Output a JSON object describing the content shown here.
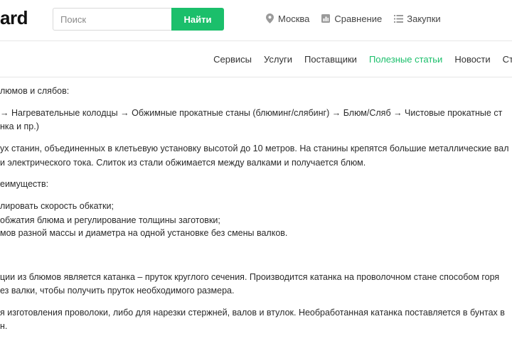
{
  "header": {
    "logo_text": "ard",
    "search": {
      "placeholder": "Поиск",
      "button_label": "Найти"
    },
    "links": [
      {
        "icon": "location-pin-icon",
        "label": "Москва"
      },
      {
        "icon": "compare-icon",
        "label": "Сравнение"
      },
      {
        "icon": "list-icon",
        "label": "Закупки"
      }
    ]
  },
  "nav": {
    "items": [
      {
        "label": "Сервисы",
        "active": false
      },
      {
        "label": "Услуги",
        "active": false
      },
      {
        "label": "Поставщики",
        "active": false
      },
      {
        "label": "Полезные статьи",
        "active": true
      },
      {
        "label": "Новости",
        "active": false
      },
      {
        "label": "Ст",
        "active": false
      }
    ]
  },
  "article": {
    "lines": [
      "люмов и слябов:",
      "→ Нагревательные колодцы → Обжимные прокатные станы (блюминг/слябинг) → Блюм/Сляб → Чистовые прокатные ст",
      "нка и пр.)",
      "ух станин, объединенных в клетьевую установку высотой до 10 метров. На станины крепятся большие металлические вал",
      "и электрического тока. Слиток из стали обжимается между валками и получается блюм.",
      "еимуществ:",
      "лировать скорость обкатки;",
      "обжатия блюма и регулирование толщины заготовки;",
      "мов разной массы и диаметра на одной установке без смены валков.",
      "ции из блюмов является катанка – пруток круглого сечения. Производится катанка на проволочном стане способом горя",
      "ез валки, чтобы получить пруток необходимого размера.",
      "я изготовления проволоки, либо для нарезки стержней, валов и втулок. Необработанная катанка поставляется в бунтах в",
      "н."
    ]
  },
  "colors": {
    "accent": "#1bbf6b",
    "text": "#2a2a2a",
    "border": "#e6e6e6"
  }
}
